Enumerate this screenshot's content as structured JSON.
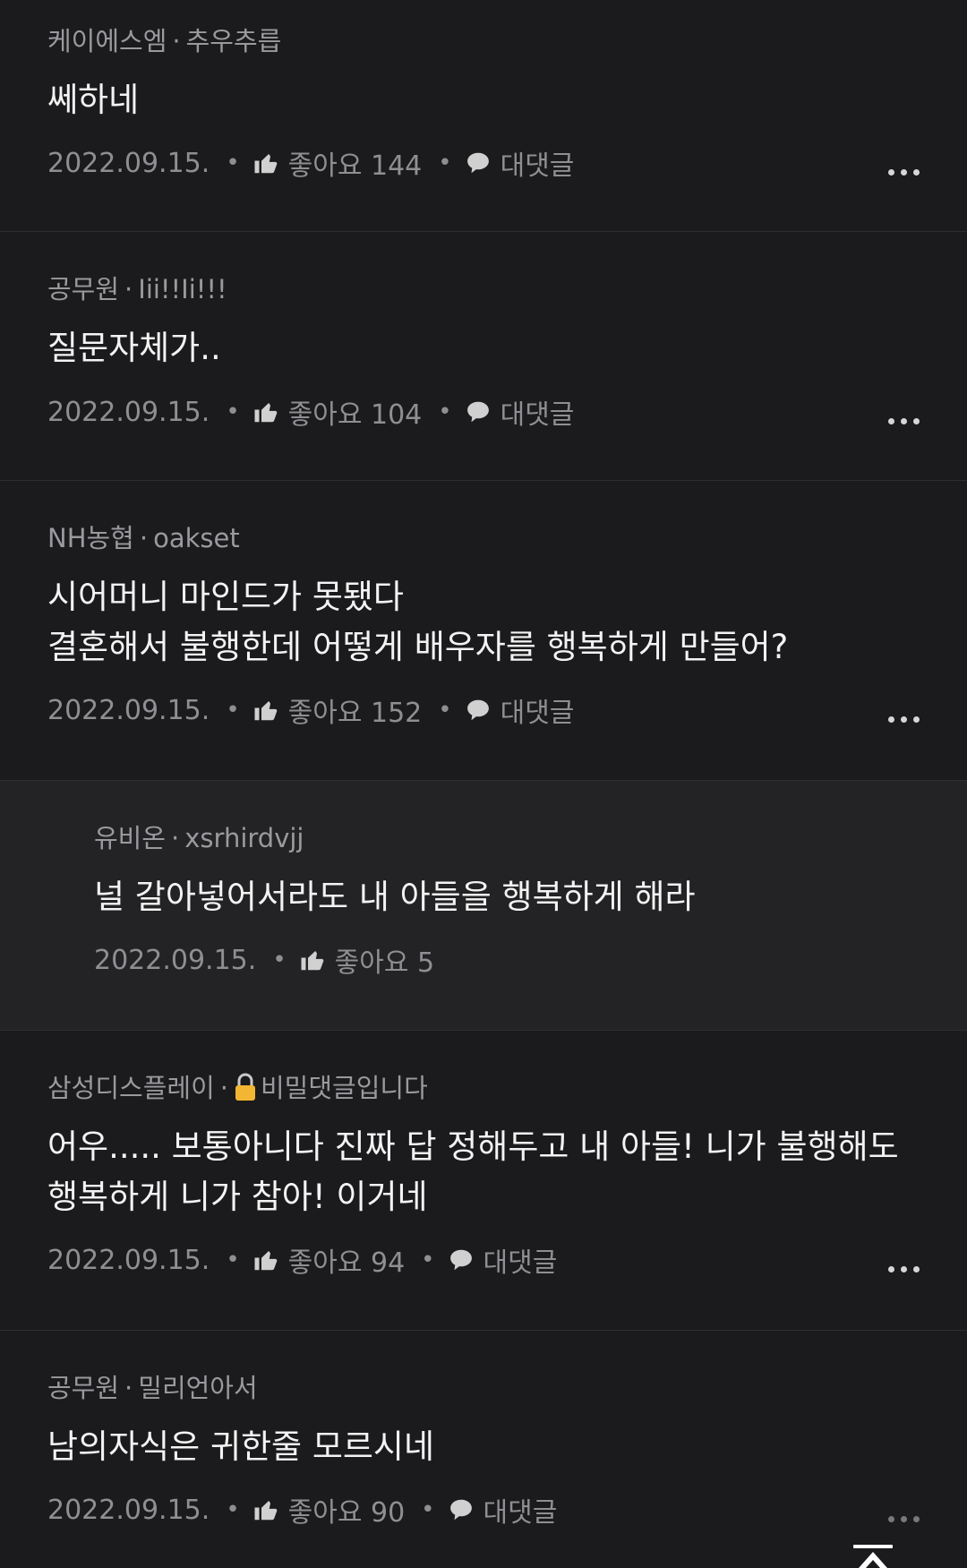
{
  "comments": [
    {
      "company": "케이에스엠",
      "nickname": "추우추릅",
      "text": "쎄하네",
      "date": "2022.09.15.",
      "likes": "좋아요 144",
      "reply_label": "대댓글"
    },
    {
      "company": "공무원",
      "nickname": "Iii!!Ii!!!",
      "text": "질문자체가..",
      "date": "2022.09.15.",
      "likes": "좋아요 104",
      "reply_label": "대댓글"
    },
    {
      "company": "NH농협",
      "nickname": "oakset",
      "text": "시어머니 마인드가 못됐다\n결혼해서 불행한데 어떻게 배우자를 행복하게 만들어?",
      "date": "2022.09.15.",
      "likes": "좋아요 152",
      "reply_label": "대댓글"
    },
    {
      "company": "유비온",
      "nickname": "xsrhirdvjj",
      "text": "널 갈아넣어서라도 내 아들을 행복하게 해라",
      "date": "2022.09.15.",
      "likes": "좋아요 5"
    },
    {
      "company": "삼성디스플레이",
      "nickname": "비밀댓글입니다",
      "text": "어우..... 보통아니다 진짜 답 정해두고 내 아들! 니가 불행해도\n행복하게 니가 참아! 이거네",
      "date": "2022.09.15.",
      "likes": "좋아요 94",
      "reply_label": "대댓글"
    },
    {
      "company": "공무원",
      "nickname": "밀리언아서",
      "text": "남의자식은 귀한줄 모르시네",
      "date": "2022.09.15.",
      "likes": "좋아요 90",
      "reply_label": "대댓글"
    }
  ],
  "icons": {
    "like": "thumbs-up-icon",
    "reply": "speech-bubble-icon",
    "more": "more-dots-icon",
    "lock": "lock-icon",
    "top": "scroll-top-arrow-icon"
  },
  "colors": {
    "background": "#1b1b1d",
    "reply_background": "#232325",
    "lock": "#f2b632"
  }
}
